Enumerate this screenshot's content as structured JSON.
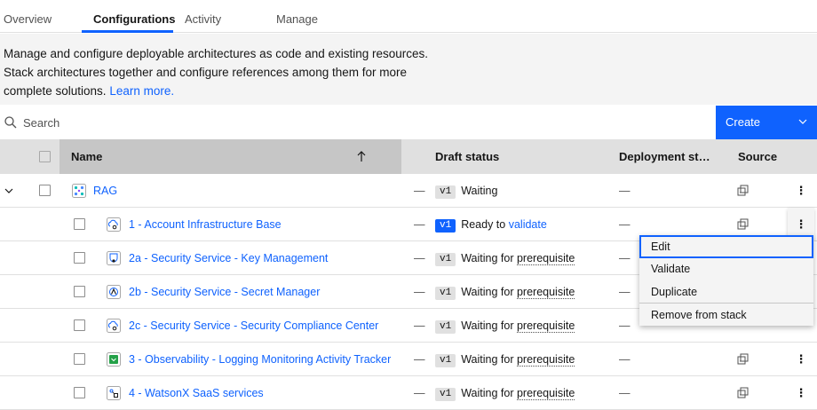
{
  "tabs": [
    {
      "label": "Overview"
    },
    {
      "label": "Configurations"
    },
    {
      "label": "Activity"
    },
    {
      "label": "Manage"
    }
  ],
  "active_tab": "Configurations",
  "description": {
    "line1": "Manage and configure deployable architectures as code and existing resources.",
    "line2": "Stack architectures together and configure references among them for more",
    "line3": "complete solutions. ",
    "link": "Learn more."
  },
  "toolbar": {
    "search_placeholder": "Search",
    "create_label": "Create"
  },
  "table": {
    "headers": {
      "name": "Name",
      "draft_status": "Draft status",
      "deployment_status": "Deployment st…",
      "source": "Source"
    },
    "sort_direction": "ascending",
    "rows": [
      {
        "name": "RAG",
        "level": 0,
        "expanded": true,
        "icon": "stack-icon",
        "dash": "—",
        "version": "v1",
        "status_text": "Waiting",
        "status_link": "",
        "deployment": "—",
        "source_icon": "catalog-icon"
      },
      {
        "name": "1 - Account Infrastructure Base",
        "level": 1,
        "icon": "cloud-gear-icon",
        "dash": "—",
        "version": "v1",
        "version_highlight": true,
        "status_text": "Ready to ",
        "status_link": "validate",
        "deployment": "—",
        "source_icon": "catalog-icon"
      },
      {
        "name": "2a - Security Service - Key Management",
        "level": 1,
        "icon": "key-shield-icon",
        "dash": "—",
        "version": "v1",
        "status_text": "Waiting for ",
        "status_link": "prerequisite",
        "deployment": "—",
        "source_icon": "catalog-icon"
      },
      {
        "name": "2b - Security Service - Secret Manager",
        "level": 1,
        "icon": "secret-icon",
        "dash": "—",
        "version": "v1",
        "status_text": "Waiting for ",
        "status_link": "prerequisite",
        "deployment": "—",
        "source_icon": "catalog-icon"
      },
      {
        "name": "2c - Security Service - Security Compliance Center",
        "level": 1,
        "icon": "cloud-gear-icon",
        "dash": "—",
        "version": "v1",
        "status_text": "Waiting for ",
        "status_link": "prerequisite",
        "deployment": "—",
        "source_icon": "catalog-icon"
      },
      {
        "name": "3 - Observability - Logging Monitoring Activity Tracker",
        "level": 1,
        "icon": "observability-icon",
        "dash": "—",
        "version": "v1",
        "status_text": "Waiting for ",
        "status_link": "prerequisite",
        "deployment": "—",
        "source_icon": "catalog-icon"
      },
      {
        "name": "4 - WatsonX SaaS services",
        "level": 1,
        "icon": "watsonx-icon",
        "dash": "—",
        "version": "v1",
        "status_text": "Waiting for ",
        "status_link": "prerequisite",
        "deployment": "—",
        "source_icon": "catalog-icon"
      }
    ]
  },
  "overflow_menu": {
    "items": [
      "Edit",
      "Validate",
      "Duplicate",
      "Remove from stack"
    ],
    "focused": "Edit"
  },
  "colors": {
    "accent": "#0f62fe",
    "banner_bg": "#f4f4f4",
    "header_bg": "#e0e0e0",
    "sorted_header_bg": "#c6c6c6"
  }
}
